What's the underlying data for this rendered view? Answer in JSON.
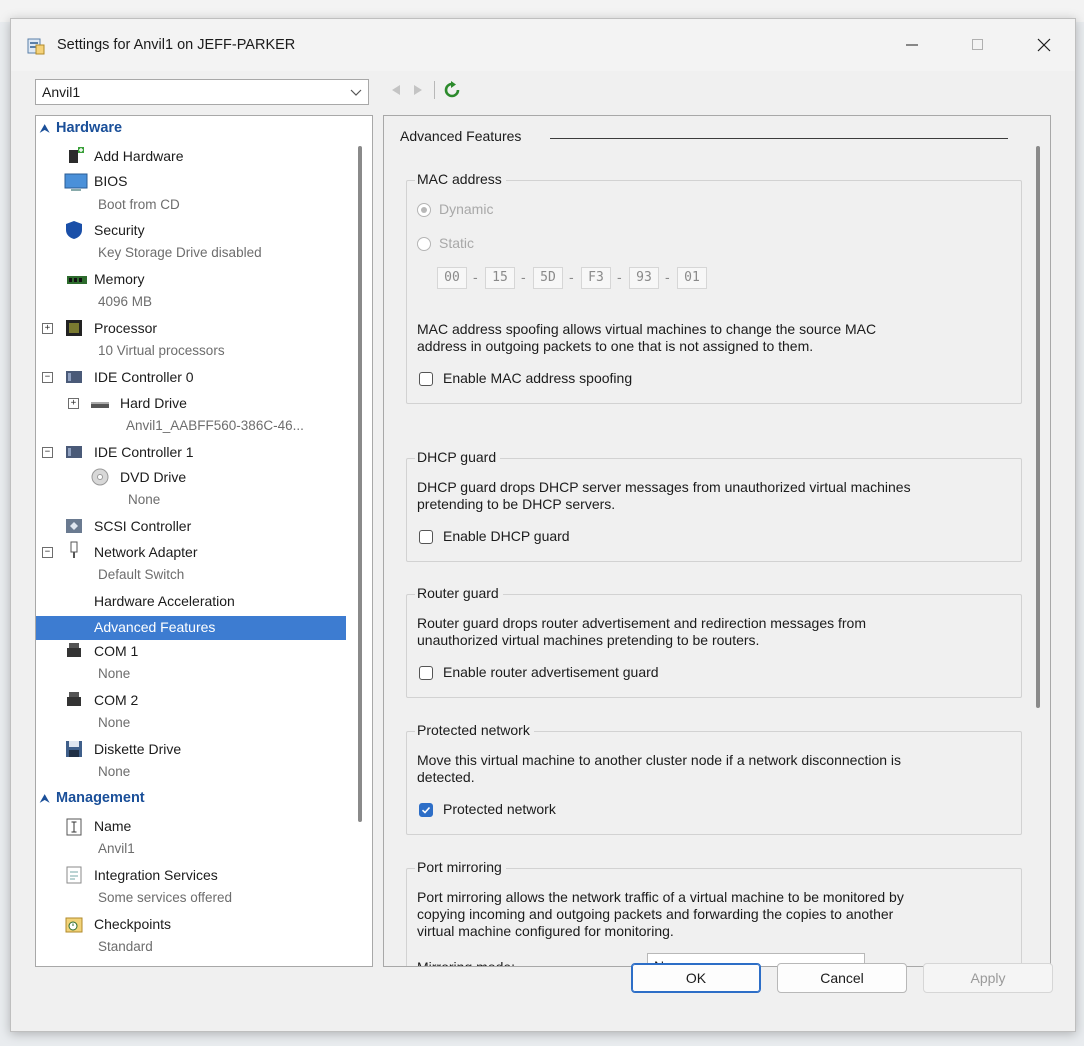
{
  "window": {
    "title": "Settings for Anvil1 on JEFF-PARKER"
  },
  "vm_selector": {
    "value": "Anvil1"
  },
  "sidebar": {
    "hardware_header": "Hardware",
    "management_header": "Management",
    "items": [
      {
        "label": "Add Hardware",
        "sub": ""
      },
      {
        "label": "BIOS",
        "sub": "Boot from CD"
      },
      {
        "label": "Security",
        "sub": "Key Storage Drive disabled"
      },
      {
        "label": "Memory",
        "sub": "4096 MB"
      },
      {
        "label": "Processor",
        "sub": "10 Virtual processors"
      },
      {
        "label": "IDE Controller 0",
        "sub": ""
      },
      {
        "label": "Hard Drive",
        "sub": "Anvil1_AABFF560-386C-46..."
      },
      {
        "label": "IDE Controller 1",
        "sub": ""
      },
      {
        "label": "DVD Drive",
        "sub": "None"
      },
      {
        "label": "SCSI Controller",
        "sub": ""
      },
      {
        "label": "Network Adapter",
        "sub": "Default Switch"
      },
      {
        "label": "Hardware Acceleration",
        "sub": ""
      },
      {
        "label": "Advanced Features",
        "sub": ""
      },
      {
        "label": "COM 1",
        "sub": "None"
      },
      {
        "label": "COM 2",
        "sub": "None"
      },
      {
        "label": "Diskette Drive",
        "sub": "None"
      },
      {
        "label": "Name",
        "sub": "Anvil1"
      },
      {
        "label": "Integration Services",
        "sub": "Some services offered"
      },
      {
        "label": "Checkpoints",
        "sub": "Standard"
      }
    ],
    "selected": "Advanced Features"
  },
  "panel": {
    "title": "Advanced Features",
    "mac": {
      "legend": "MAC address",
      "dynamic_label": "Dynamic",
      "static_label": "Static",
      "selected": "Dynamic",
      "octets": [
        "00",
        "15",
        "5D",
        "F3",
        "93",
        "01"
      ],
      "separator": "-",
      "spoof_desc_1": "MAC address spoofing allows virtual machines to change the source MAC",
      "spoof_desc_2": "address in outgoing packets to one that is not assigned to them.",
      "spoof_label": "Enable MAC address spoofing",
      "spoof_checked": false
    },
    "dhcp": {
      "legend": "DHCP guard",
      "desc_1": "DHCP guard drops DHCP server messages from unauthorized virtual machines",
      "desc_2": "pretending to be DHCP servers.",
      "label": "Enable DHCP guard",
      "checked": false
    },
    "router": {
      "legend": "Router guard",
      "desc_1": "Router guard drops router advertisement and redirection messages from",
      "desc_2": "unauthorized virtual machines pretending to be routers.",
      "label": "Enable router advertisement guard",
      "checked": false
    },
    "protected": {
      "legend": "Protected network",
      "desc_1": "Move this virtual machine to another cluster node if a network disconnection is",
      "desc_2": "detected.",
      "label": "Protected network",
      "checked": true
    },
    "mirroring": {
      "legend": "Port mirroring",
      "desc_1": "Port mirroring allows the network traffic of a virtual machine to be monitored by",
      "desc_2": "copying incoming and outgoing packets and forwarding the copies to another",
      "desc_3": "virtual machine configured for monitoring.",
      "mode_label": "Mirroring mode:",
      "mode_value": "None"
    }
  },
  "buttons": {
    "ok": "OK",
    "cancel": "Cancel",
    "apply": "Apply"
  },
  "colors": {
    "accent": "#3d7cd1",
    "header_blue": "#1a4f99",
    "refresh_green": "#2c8a2c"
  }
}
